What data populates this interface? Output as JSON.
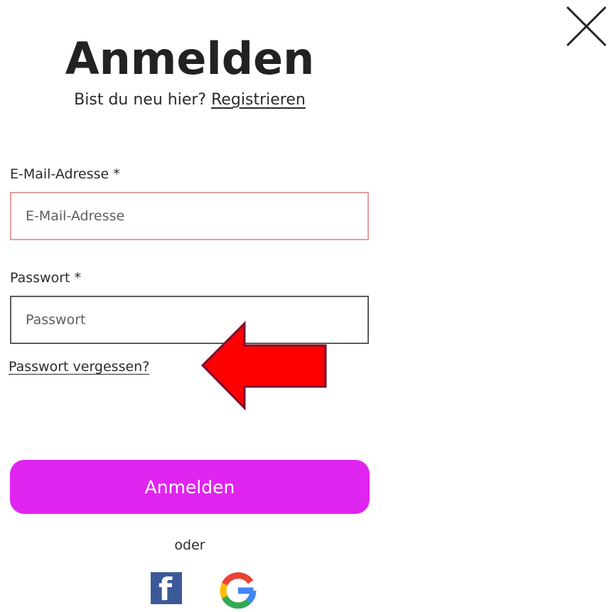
{
  "header": {
    "title": "Anmelden",
    "subtitle_text": "Bist du neu hier?",
    "register_link": "Registrieren"
  },
  "form": {
    "email": {
      "label": "E-Mail-Adresse *",
      "placeholder": "E-Mail-Adresse",
      "value": ""
    },
    "password": {
      "label": "Passwort *",
      "placeholder": "Passwort",
      "value": ""
    },
    "forgot_password_link": "Passwort vergessen?",
    "submit_label": "Anmelden"
  },
  "social": {
    "divider_text": "oder",
    "facebook_icon": "facebook-icon",
    "facebook_glyph": "f",
    "google_icon": "google-icon"
  },
  "icons": {
    "close": "close-icon",
    "annotation": "red-arrow-icon"
  },
  "colors": {
    "accent": "#e024ef",
    "error_border": "#e39f9f",
    "facebook": "#3b5998",
    "annotation_arrow": "#ff0000"
  }
}
